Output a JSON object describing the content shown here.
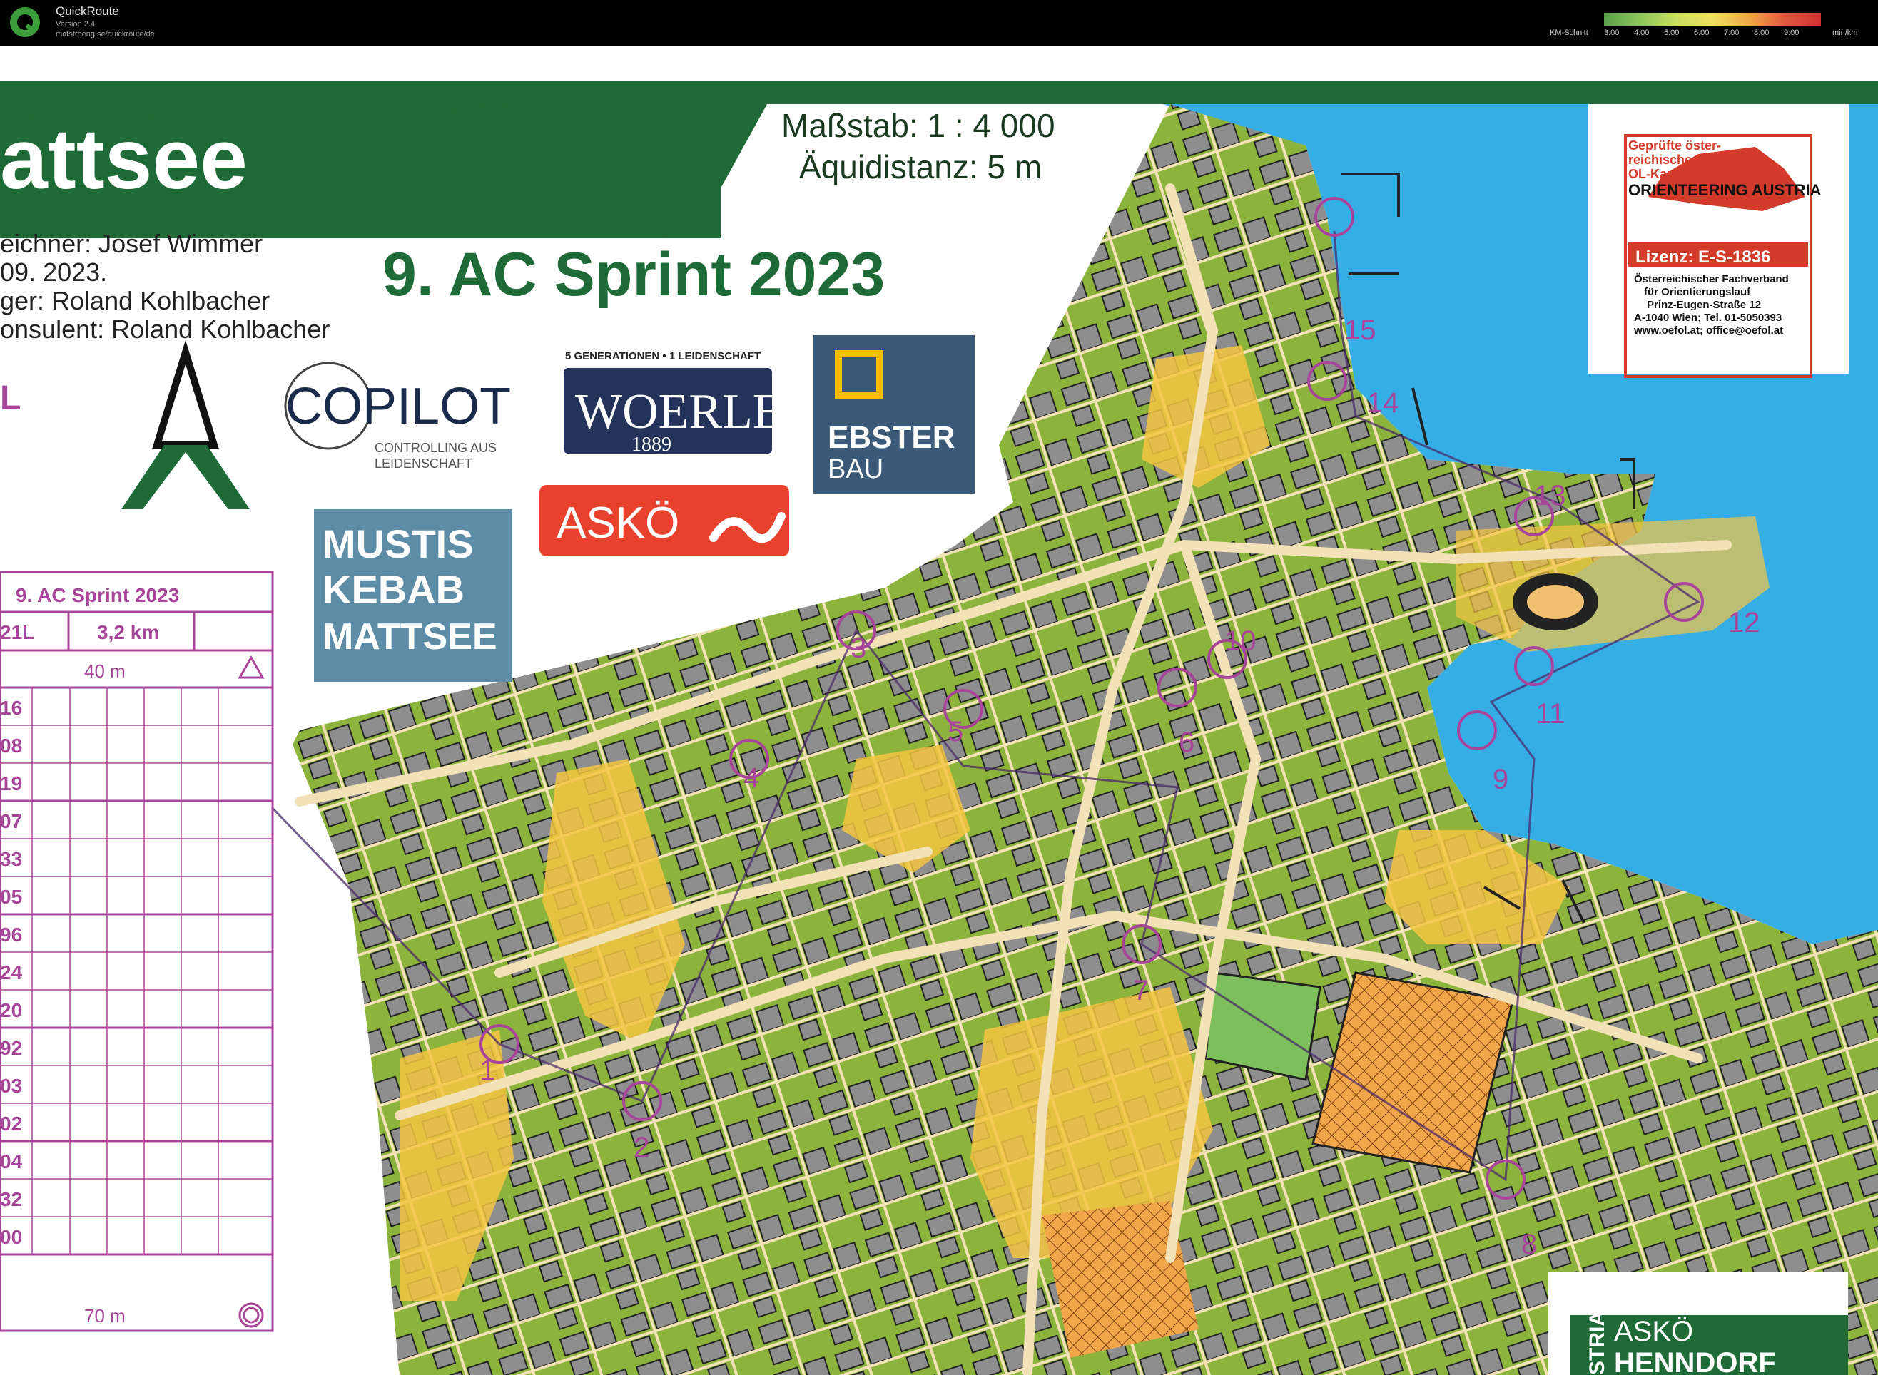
{
  "app": {
    "name": "QuickRoute",
    "version": "Version 2.4",
    "url": "matstroeng.se/quickroute/de",
    "speed_label": "KM-Schnitt",
    "speed_ticks": [
      "3:00",
      "4:00",
      "5:00",
      "6:00",
      "7:00",
      "8:00",
      "9:00"
    ],
    "speed_unit": "min/km"
  },
  "map": {
    "title": "attsee",
    "event": "9. AC Sprint 2023",
    "scale": "Maßstab: 1 : 4 000",
    "contour": "Äquidistanz: 5 m",
    "credits": [
      "eichner: Josef Wimmer",
      "09. 2023.",
      "ger: Roland Kohlbacher",
      "onsulent: Roland Kohlbacher"
    ],
    "class_letter": "L",
    "sponsors": {
      "copilot": "COPILOT",
      "copilot_tag1": "CONTROLLING AUS",
      "copilot_tag2": "LEIDENSCHAFT",
      "woerle_tag": "5 GENERATIONEN • 1 LEIDENSCHAFT",
      "woerle": "WOERLE",
      "woerle_year": "1889",
      "ebster1": "EBSTER",
      "ebster2": "BAU",
      "askoe": "ASKÖ",
      "mustis1": "MUSTIS",
      "mustis2": "KEBAB",
      "mustis3": "MATTSEE"
    },
    "badge": {
      "line1": "Geprüfte öster-",
      "line2": "reichische",
      "line3": "OL-Karte",
      "line4": "ORIENTEERING AUSTRIA",
      "licence": "Lizenz: E-S-1836",
      "org1": "Österreichischer Fachverband",
      "org2": "für Orientierungslauf",
      "addr1": "Prinz-Eugen-Straße 12",
      "addr2": "A-1040 Wien; Tel. 01-5050393",
      "web": "www.oefol.at; office@oefol.at"
    },
    "club_side": "STRIA",
    "club1": "ASKÖ",
    "club2": "HENNDORF",
    "controls": [
      "1",
      "2",
      "3",
      "4",
      "5",
      "6",
      "7",
      "8",
      "9",
      "10",
      "11",
      "12",
      "13",
      "14",
      "15"
    ]
  },
  "description": {
    "title": "9. AC Sprint 2023",
    "course": "21L",
    "length": "3,2 km",
    "start_leg": "40 m",
    "finish_leg": "70 m",
    "codes": [
      "16",
      "08",
      "19",
      "07",
      "33",
      "05",
      "96",
      "24",
      "20",
      "92",
      "03",
      "02",
      "04",
      "32",
      "00"
    ]
  },
  "colors": {
    "map_green": "#1f6b37",
    "water": "#35aee6",
    "vegetation": "#8cb43c",
    "open_land": "#f5c542",
    "building": "#8c8c8c",
    "control": "#a8449a",
    "route": "#4a2a6a"
  }
}
